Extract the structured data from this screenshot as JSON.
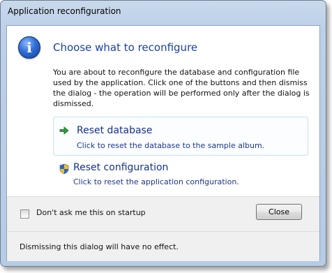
{
  "window": {
    "title": "Application reconfiguration"
  },
  "main": {
    "icon": "information-icon",
    "instruction": "Choose what to reconfigure",
    "message": "You are about to reconfigure the database and configuration file used by the application.  Click one of the buttons and then dismiss the dialog - the operation will be performed only after the dialog is dismissed."
  },
  "commands": [
    {
      "icon": "green-arrow-icon",
      "title": "Reset database",
      "description": "Click to reset the database to the sample album."
    },
    {
      "icon": "shield-icon",
      "title": "Reset configuration",
      "description": "Click to reset the application configuration."
    }
  ],
  "footer": {
    "checkbox_label": "Don't ask me this on startup",
    "checkbox_checked": false,
    "close_label": "Close",
    "footer_text": "Dismissing this dialog will have no effect."
  }
}
